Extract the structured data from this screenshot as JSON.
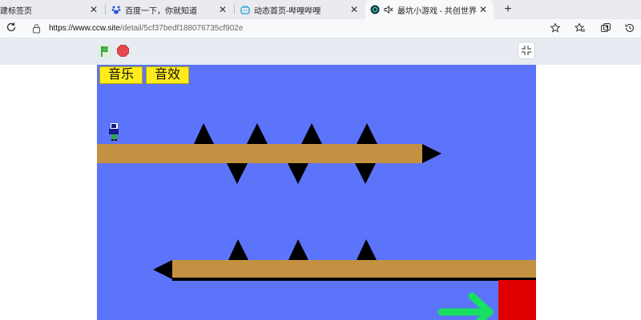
{
  "tabs": [
    {
      "title": "建标签页",
      "icon": "tab-icon",
      "active": false
    },
    {
      "title": "百度一下，你就知道",
      "icon": "baidu-icon",
      "active": false
    },
    {
      "title": "动态首页-哔哩哔哩",
      "icon": "bilibili-icon",
      "active": false
    },
    {
      "title": "最坑小游戏 - 共创世界",
      "icon": "ccw-icon",
      "active": true
    }
  ],
  "address": {
    "url_host": "https://www.ccw.site",
    "url_path": "/detail/5cf37bedf188076735cf902e"
  },
  "game": {
    "music_label": "音乐",
    "sound_label": "音效"
  },
  "colors": {
    "stage": "#5c74fa",
    "platform": "#c49142",
    "spike": "#000000",
    "goal": "#e00000",
    "arrow": "#17e060",
    "button": "#ffec1a"
  }
}
